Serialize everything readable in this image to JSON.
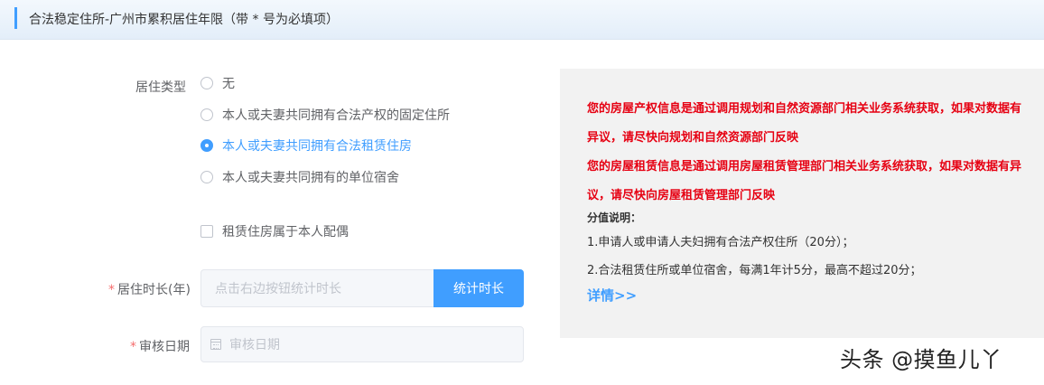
{
  "header": {
    "title": "合法稳定住所-广州市累积居住年限（带 * 号为必填项）"
  },
  "form": {
    "residence_type": {
      "label": "居住类型",
      "options": [
        {
          "label": "无",
          "checked": false
        },
        {
          "label": "本人或夫妻共同拥有合法产权的固定住所",
          "checked": false
        },
        {
          "label": "本人或夫妻共同拥有合法租赁住房",
          "checked": true
        },
        {
          "label": "本人或夫妻共同拥有的单位宿舍",
          "checked": false
        }
      ]
    },
    "spouse_checkbox": {
      "label": "租赁住房属于本人配偶",
      "checked": false
    },
    "duration": {
      "required_mark": "*",
      "label": "居住时长(年)",
      "placeholder": "点击右边按钮统计时长",
      "button_label": "统计时长"
    },
    "review_date": {
      "required_mark": "*",
      "label": "审核日期",
      "placeholder": "审核日期",
      "icon": "calendar-icon"
    }
  },
  "info": {
    "property_notice": "您的房屋产权信息是通过调用规划和自然资源部门相关业务系统获取，如果对数据有异议，请尽快向规划和自然资源部门反映",
    "rental_notice": "您的房屋租赁信息是通过调用房屋租赁管理部门相关业务系统获取，如果对数据有异议，请尽快向房屋租赁管理部门反映",
    "score_title": "分值说明：",
    "score_items": [
      "1.申请人或申请人夫妇拥有合法产权住所（20分）；",
      "2.合法租赁住所或单位宿舍，每满1年计5分，最高不超过20分；"
    ],
    "details_link": "详情>>"
  },
  "watermark": "头条 @摸鱼儿丫",
  "colors": {
    "accent": "#409eff",
    "warning_text": "#e60012",
    "required": "#f56c6c"
  }
}
